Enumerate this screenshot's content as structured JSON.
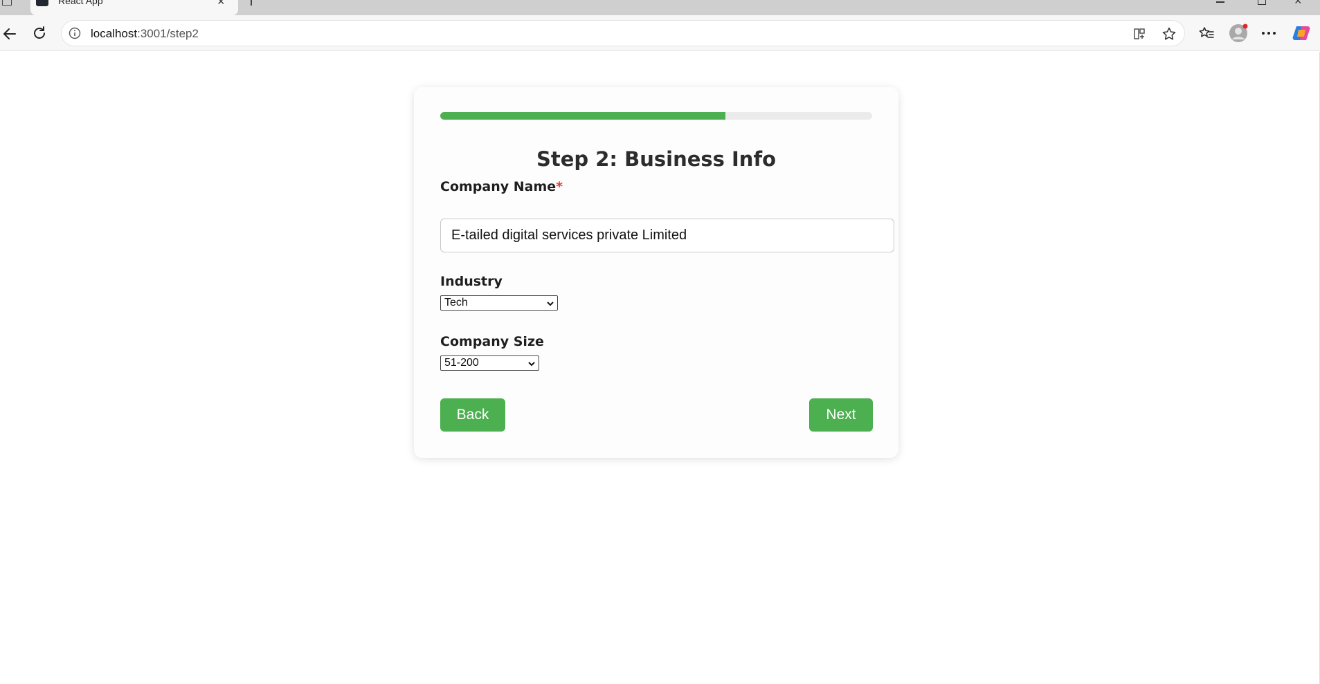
{
  "browser": {
    "tab_title": "React App",
    "url_host": "localhost",
    "url_rest": ":3001/step2"
  },
  "progress": {
    "fraction": 0.66
  },
  "form": {
    "title": "Step 2: Business Info",
    "company_name": {
      "label": "Company Name",
      "required_mark": "*",
      "value": "E-tailed digital services private Limited"
    },
    "industry": {
      "label": "Industry",
      "selected": "Tech"
    },
    "company_size": {
      "label": "Company Size",
      "selected": "51-200"
    },
    "back_label": "Back",
    "next_label": "Next"
  },
  "colors": {
    "accent": "#4caf50",
    "required": "#e53935"
  }
}
